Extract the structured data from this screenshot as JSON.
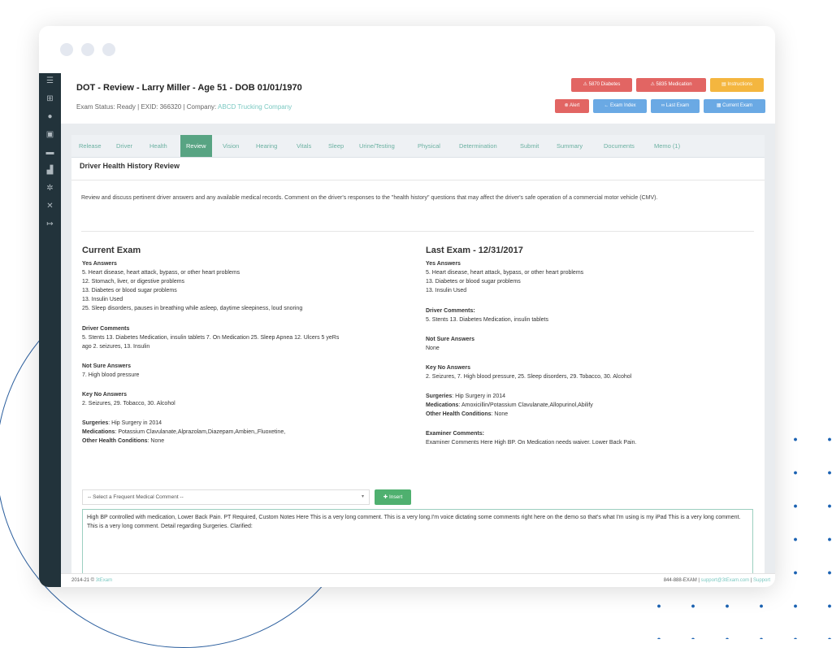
{
  "header": {
    "title": "DOT - Review - Larry Miller - Age 51 - DOB 01/01/1970",
    "status_prefix": "Exam Status: Ready | EXID: 366320 | Company: ",
    "company": "ABCD Trucking Company",
    "buttons_top": [
      "5870 Diabetes",
      "5835 Medication",
      "Instructions"
    ],
    "buttons_bottom": [
      "Alert",
      "Exam Index",
      "Last Exam",
      "Current Exam"
    ]
  },
  "tabs": [
    "Release",
    "Driver",
    "Health",
    "Review",
    "Vision",
    "Hearing",
    "Vitals",
    "Sleep",
    "Urine/Testing",
    "Physical",
    "Determination",
    "Submit",
    "Summary",
    "Documents",
    "Memo (1)"
  ],
  "active_tab": "Review",
  "section_title": "Driver Health History Review",
  "intro": "Review and discuss pertinent driver answers and any available medical records. Comment on the driver's responses to the \"health history\" questions that may affect the driver's safe operation of a commercial motor vehicle (CMV).",
  "current": {
    "title": "Current Exam",
    "yes_label": "Yes Answers",
    "yes": [
      "5. Heart disease, heart attack, bypass, or other heart problems",
      "12. Stomach, liver, or digestive problems",
      "13. Diabetes or blood sugar problems",
      "13. Insulin Used",
      "25. Sleep disorders, pauses in breathing while asleep, daytime sleepiness, loud snoring"
    ],
    "comments_label": "Driver Comments",
    "comments": [
      "5. Stents 13. Diabetes Medication, insulin tablets 7. On Medication 25. Sleep Apnea 12. Ulcers 5 yeRs",
      "ago 2. seizures, 13. Insulin"
    ],
    "notsure_label": "Not Sure Answers",
    "notsure": "7. High blood pressure",
    "keyno_label": "Key No Answers",
    "keyno": "2. Seizures, 29. Tobacco, 30. Alcohol",
    "surgeries_label": "Surgeries",
    "surgeries": ": Hip Surgery in 2014",
    "medications_label": "Medications",
    "medications": ": Potassium Clavulanate,Alprazolam,Diazepam,Ambien,,Fluoxetine,",
    "other_label": "Other Health Conditions",
    "other": ": None"
  },
  "last": {
    "title": "Last Exam - 12/31/2017",
    "yes_label": "Yes Answers",
    "yes": [
      "5. Heart disease, heart attack, bypass, or other heart problems",
      "13. Diabetes or blood sugar problems",
      "13. Insulin Used"
    ],
    "comments_label": "Driver Comments:",
    "comments": "5. Stents 13. Diabetes Medication, insulin tablets",
    "notsure_label": "Not Sure Answers",
    "notsure": "None",
    "keyno_label": "Key No Answers",
    "keyno": "2. Seizures, 7. High blood pressure, 25. Sleep disorders, 29. Tobacco, 30. Alcohol",
    "surgeries_label": "Surgeries",
    "surgeries": ": Hip Surgery in 2014",
    "medications_label": "Medications",
    "medications": ": Amoxicillin/Potassium Clavulanate,Allopurinol,Abilify",
    "other_label": "Other Health Conditions",
    "other": ": None",
    "examiner_label": "Examiner Comments:",
    "examiner": "Examiner Comments Here High BP. On Medication needs waiver. Lower Back Pain."
  },
  "comment_select": {
    "value": "-- Select a Frequent Medical Comment --",
    "insert_label": "Insert"
  },
  "comment_text": "High BP controlled with medication, Lower Back Pain. PT Required, Custom Notes Here This is a very long comment. This is a very long.I'm voice dictating some comments right here on the demo so that's what I'm using is my iPad This is a very long comment. This is a very long comment. Detail regarding Surgeries. Clarified:",
  "footer": {
    "copyright": "2014-21 © ",
    "brand": "3tExam",
    "phone": "844-888-EXAM  |  ",
    "email": "support@3tExam.com",
    "sep": "  |  ",
    "support": "Support"
  },
  "colors": {
    "sidebar": "#22333b",
    "active_tab": "#58a483",
    "tab_text": "#6cb1a2",
    "red_button": "#e26563",
    "orange_button": "#f4b63f",
    "blue_button": "#6aa9e4",
    "insert_button": "#4fb06f"
  },
  "icons": [
    "list-icon",
    "hospital-icon",
    "user-icon",
    "truck-icon",
    "folder-icon",
    "chart-icon",
    "gear-icon",
    "tools-icon",
    "logout-icon",
    "warning-icon",
    "alert-icon",
    "back-icon",
    "link-icon",
    "calendar-icon",
    "plus-icon"
  ]
}
